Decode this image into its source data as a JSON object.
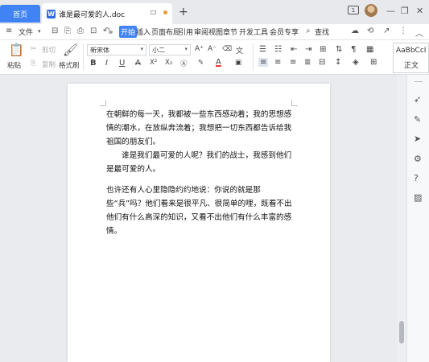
{
  "tabs": {
    "home": "首页",
    "doc_icon": "W",
    "doc_title": "谁是最可爱的人.doc",
    "new_tab": "+"
  },
  "window": {
    "badge": "1",
    "minimize": "—",
    "maximize": "❐",
    "close": "✕"
  },
  "menubar": {
    "file": "文件",
    "items": [
      "开始",
      "插入",
      "页面布局",
      "引用",
      "审阅",
      "视图",
      "章节",
      "开发工具",
      "会员专享"
    ],
    "search": "查找",
    "more": "»"
  },
  "ribbon": {
    "paste": "粘贴",
    "cut": "剪切",
    "copy": "复制",
    "format_painter": "格式刷",
    "font_name": "新宋体",
    "font_size": "小二",
    "bold": "B",
    "italic": "I",
    "underline": "U",
    "strike": "A",
    "superscript": "X²",
    "subscript": "X₂",
    "font_color": "A",
    "grow": "A⁺",
    "shrink": "A⁻",
    "wen": "文",
    "style_preview": "AaBbCcI",
    "style_name": "正文"
  },
  "document": {
    "paragraphs": [
      "在朝鲜的每一天，我都被一些东西感动着；我的思想感情的潮水，在放纵奔流着；我想把一切东西都告诉给我祖国的朋友们。",
      "谁是我们最可爱的人呢？我们的战士，我感到他们是最可爱的人。",
      "也许还有人心里隐隐约约地说：你说的就是那些“兵”吗？他们看来是很平凡、很简单的哩，既看不出他们有什么高深的知识，又看不出他们有什么丰富的感情。"
    ]
  },
  "colors": {
    "accent": "#3f83f4",
    "doc_icon": "#2f6de1",
    "unsaved_dot": "#f09a32"
  },
  "icons": [
    "minimize-icon",
    "maximize-icon",
    "close-icon",
    "search-icon",
    "cloud-icon",
    "share-icon",
    "pen-icon",
    "cursor-icon",
    "help-icon",
    "image-icon"
  ]
}
